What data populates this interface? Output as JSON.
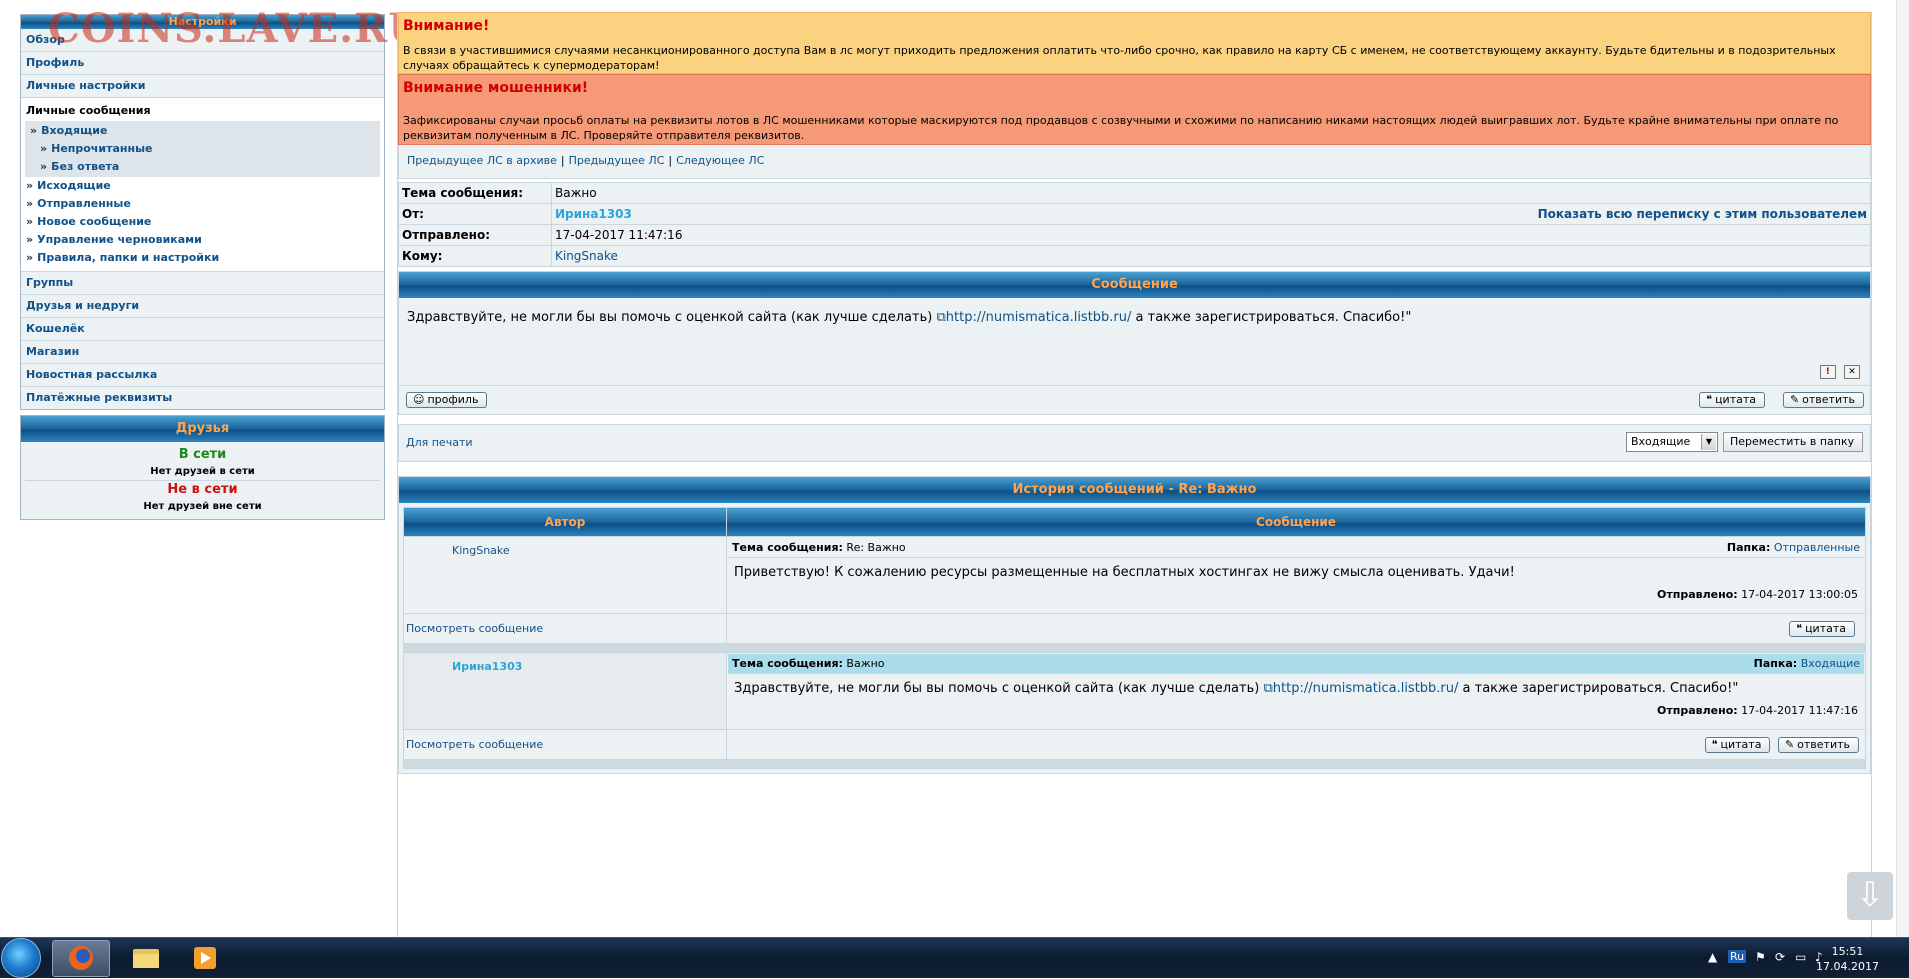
{
  "watermark": "COINS.LAVE.RU",
  "sidebar": {
    "header": "Настройки",
    "top_items": [
      "Обзор",
      "Профиль",
      "Личные настройки"
    ],
    "pm_title": "Личные сообщения",
    "pm_inbox": "Входящие",
    "pm_unread": "Непрочитанные",
    "pm_noreply": "Без ответа",
    "pm_items": [
      "Исходящие",
      "Отправленные",
      "Новое сообщение",
      "Управление черновиками",
      "Правила, папки и настройки"
    ],
    "bottom_items": [
      "Группы",
      "Друзья и недруги",
      "Кошелёк",
      "Магазин",
      "Новостная рассылка",
      "Платёжные реквизиты"
    ]
  },
  "friends": {
    "header": "Друзья",
    "online_label": "В сети",
    "online_none": "Нет друзей в сети",
    "offline_label": "Не в сети",
    "offline_none": "Нет друзей вне сети"
  },
  "warning1": {
    "title": "Внимание!",
    "text": "В связи в участившимися случаями несанкционированного доступа Вам в лс могут приходить предложения оплатить что-либо срочно, как правило на карту СБ с именем, не соответствующему аккаунту. Будьте бдительны и в подозрительных случаях обращайтесь к супермодераторам!"
  },
  "warning2": {
    "title": "Внимание мошенники!",
    "text": "Зафиксированы случаи просьб оплаты на реквизиты лотов в ЛС мошенниками которые маскируются под продавцов с созвучными и схожими по написанию никами настоящих людей выигравших лот. Будьте крайне внимательны при оплате по реквизитам полученным в ЛС. Проверяйте отправителя реквизитов."
  },
  "pm_nav": {
    "prev_archive": "Предыдущее ЛС в архиве",
    "prev": "Предыдущее ЛС",
    "next": "Следующее ЛС"
  },
  "header": {
    "subject_label": "Тема сообщения:",
    "subject": "Важно",
    "from_label": "От:",
    "from": "Ирина1303",
    "show_all": "Показать всю переписку с этим пользователем",
    "sent_label": "Отправлено:",
    "sent": "17-04-2017 11:47:16",
    "to_label": "Кому:",
    "to": "KingSnake"
  },
  "message": {
    "header": "Сообщение",
    "text_before": "Здравствуйте, не могли бы вы помочь с оценкой сайта (как лучше сделать) ",
    "link": "http://numismatica.listbb.ru/",
    "text_after": " а также зарегистрироваться. Спасибо!\"",
    "report_icon": "!",
    "delete_icon": "✕"
  },
  "buttons": {
    "profile": "профиль",
    "quote": "цитата",
    "reply": "ответить"
  },
  "print_row": {
    "print": "Для печати",
    "folder_selected": "Входящие",
    "move": "Переместить в папку"
  },
  "history": {
    "title": "История сообщений - Re: Важно",
    "col_author": "Автор",
    "col_message": "Сообщение",
    "subject_label": "Тема сообщения:",
    "folder_label": "Папка:",
    "sent_label": "Отправлено:",
    "view": "Посмотреть сообщение",
    "items": [
      {
        "author": "KingSnake",
        "subject": "Re: Важно",
        "folder": "Отправленные",
        "text": "Приветствую! К сожалению ресурсы размещенные на бесплатных хостингах не вижу смысла оценивать. Удачи!",
        "sent": "17-04-2017 13:00:05"
      },
      {
        "author": "Ирина1303",
        "subject": "Важно",
        "folder": "Входящие",
        "text_before": "Здравствуйте, не могли бы вы помочь с оценкой сайта (как лучше сделать) ",
        "link": "http://numismatica.listbb.ru/",
        "text_after": " а также зарегистрироваться. Спасибо!\"",
        "sent": "17-04-2017 11:47:16"
      }
    ]
  },
  "taskbar": {
    "lang": "Ru",
    "time": "15:51",
    "date": "17.04.2017"
  },
  "colors": {
    "accent": "#105289",
    "header_text": "#ffa34f",
    "warn_yellow": "#fbd27f",
    "warn_orange": "#f59976"
  }
}
